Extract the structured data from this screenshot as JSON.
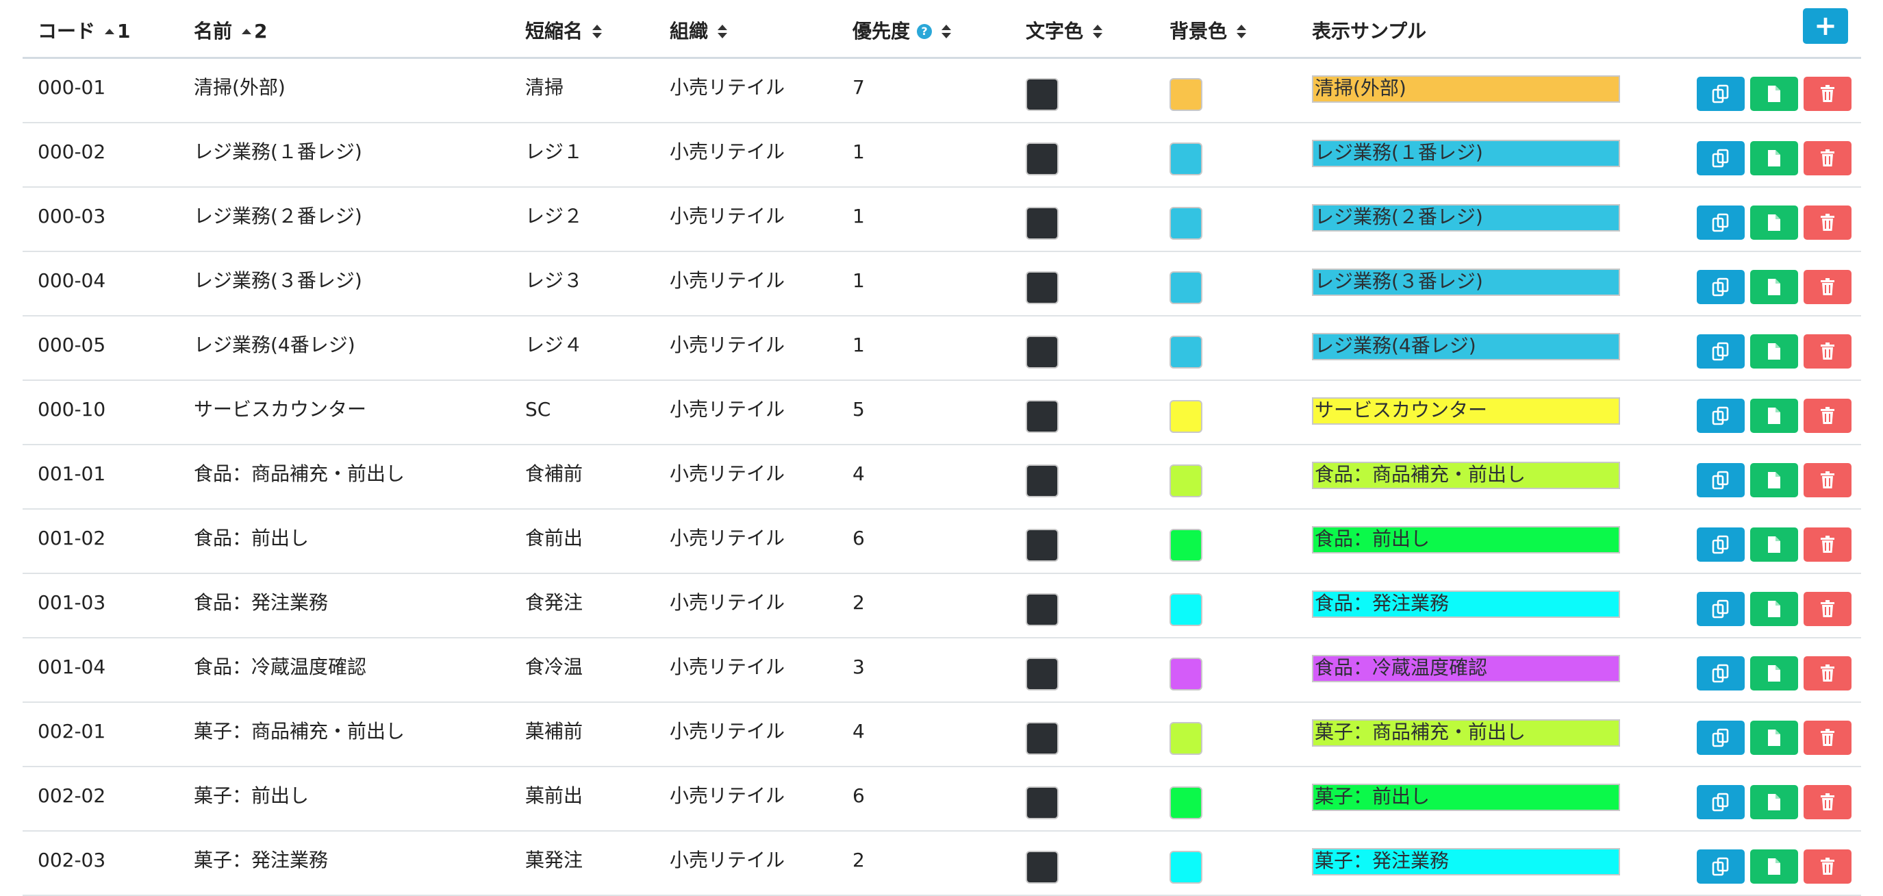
{
  "columns": {
    "code": "コード",
    "code_sort_order": "1",
    "name": "名前",
    "name_sort_order": "2",
    "short_name": "短縮名",
    "organization": "組織",
    "priority": "優先度",
    "text_color": "文字色",
    "bg_color": "背景色",
    "sample": "表示サンプル"
  },
  "help_icon": "?",
  "add_button": "+",
  "icons": {
    "header_sort": "sort-icon",
    "ascending": "sort-asc-icon",
    "copy": "copy-icon",
    "document": "document-icon",
    "delete": "trash-icon"
  },
  "colors": {
    "primary": "#14a1d4",
    "success": "#14c06a",
    "danger": "#f25f5f",
    "text_swatch": "#2b2f33"
  },
  "rows": [
    {
      "code": "000-01",
      "name": "清掃(外部)",
      "short": "清掃",
      "org": "小売リテイル",
      "priority": "7",
      "text_color": "#2b2f33",
      "bg_color": "#f9c34a",
      "sample": "清掃(外部)"
    },
    {
      "code": "000-02",
      "name": "レジ業務(１番レジ)",
      "short": "レジ１",
      "org": "小売リテイル",
      "priority": "1",
      "text_color": "#2b2f33",
      "bg_color": "#33c3e2",
      "sample": "レジ業務(１番レジ)"
    },
    {
      "code": "000-03",
      "name": "レジ業務(２番レジ)",
      "short": "レジ２",
      "org": "小売リテイル",
      "priority": "1",
      "text_color": "#2b2f33",
      "bg_color": "#33c3e2",
      "sample": "レジ業務(２番レジ)"
    },
    {
      "code": "000-04",
      "name": "レジ業務(３番レジ)",
      "short": "レジ３",
      "org": "小売リテイル",
      "priority": "1",
      "text_color": "#2b2f33",
      "bg_color": "#33c3e2",
      "sample": "レジ業務(３番レジ)"
    },
    {
      "code": "000-05",
      "name": "レジ業務(4番レジ)",
      "short": "レジ４",
      "org": "小売リテイル",
      "priority": "1",
      "text_color": "#2b2f33",
      "bg_color": "#33c3e2",
      "sample": "レジ業務(4番レジ)"
    },
    {
      "code": "000-10",
      "name": "サービスカウンター",
      "short": "SC",
      "org": "小売リテイル",
      "priority": "5",
      "text_color": "#2b2f33",
      "bg_color": "#fbfb3a",
      "sample": "サービスカウンター"
    },
    {
      "code": "001-01",
      "name": "食品：商品補充・前出し",
      "short": "食補前",
      "org": "小売リテイル",
      "priority": "4",
      "text_color": "#2b2f33",
      "bg_color": "#bdfb3c",
      "sample": "食品：商品補充・前出し"
    },
    {
      "code": "001-02",
      "name": "食品：前出し",
      "short": "食前出",
      "org": "小売リテイル",
      "priority": "6",
      "text_color": "#2b2f33",
      "bg_color": "#0bf94a",
      "sample": "食品：前出し"
    },
    {
      "code": "001-03",
      "name": "食品：発注業務",
      "short": "食発注",
      "org": "小売リテイル",
      "priority": "2",
      "text_color": "#2b2f33",
      "bg_color": "#0bfbfb",
      "sample": "食品：発注業務"
    },
    {
      "code": "001-04",
      "name": "食品：冷蔵温度確認",
      "short": "食冷温",
      "org": "小売リテイル",
      "priority": "3",
      "text_color": "#2b2f33",
      "bg_color": "#d45cf9",
      "sample": "食品：冷蔵温度確認"
    },
    {
      "code": "002-01",
      "name": "菓子：商品補充・前出し",
      "short": "菓補前",
      "org": "小売リテイル",
      "priority": "4",
      "text_color": "#2b2f33",
      "bg_color": "#bdfb3c",
      "sample": "菓子：商品補充・前出し"
    },
    {
      "code": "002-02",
      "name": "菓子：前出し",
      "short": "菓前出",
      "org": "小売リテイル",
      "priority": "6",
      "text_color": "#2b2f33",
      "bg_color": "#0bf94a",
      "sample": "菓子：前出し"
    },
    {
      "code": "002-03",
      "name": "菓子：発注業務",
      "short": "菓発注",
      "org": "小売リテイル",
      "priority": "2",
      "text_color": "#2b2f33",
      "bg_color": "#0bfbfb",
      "sample": "菓子：発注業務"
    }
  ]
}
